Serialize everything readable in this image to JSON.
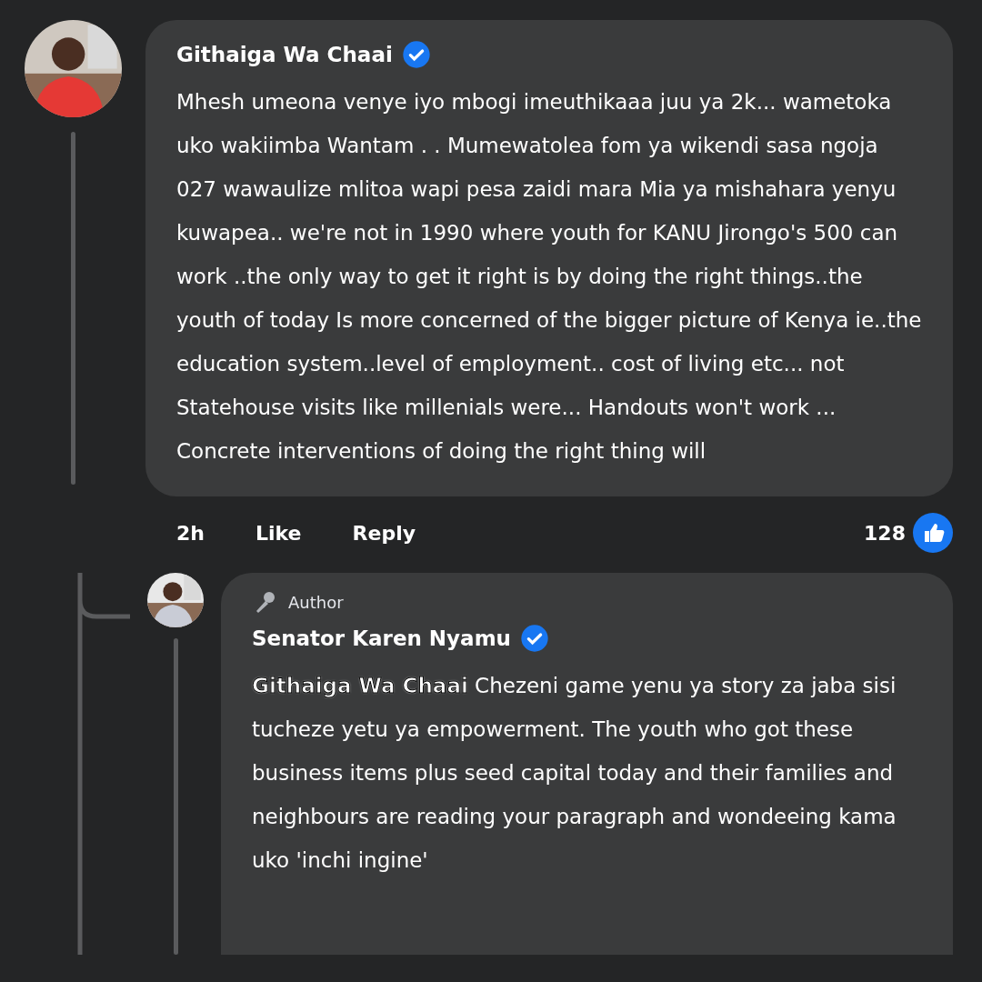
{
  "comment": {
    "author": "Githaiga Wa Chaai",
    "verified": true,
    "text": "Mhesh umeona venye iyo mbogi imeuthikaaa juu ya 2k... wametoka uko wakiimba Wantam . . Mumewatolea fom ya wikendi sasa ngoja 027 wawaulize mlitoa wapi pesa zaidi mara Mia ya mishahara yenyu kuwapea.. we're not in 1990 where youth for KANU Jirongo's 500 can work ..the only way to get it right is by doing the right things..the youth of today Is more concerned of the bigger picture of Kenya ie..the education system..level of employment.. cost of living  etc... not Statehouse visits like millenials were... Handouts won't work ... Concrete interventions of doing the right thing will",
    "time": "2h",
    "actions": [
      "Like",
      "Reply"
    ],
    "reactions": "128"
  },
  "reply": {
    "badge": "Author",
    "author": "Senator Karen Nyamu",
    "verified": true,
    "mention": "Githaiga Wa Chaai",
    "text": "Chezeni game yenu ya story za jaba sisi tucheze yetu ya empowerment. The youth who got these business items plus seed capital today and their families and neighbours are reading your paragraph and wondeeing kama uko 'inchi ingine'"
  }
}
